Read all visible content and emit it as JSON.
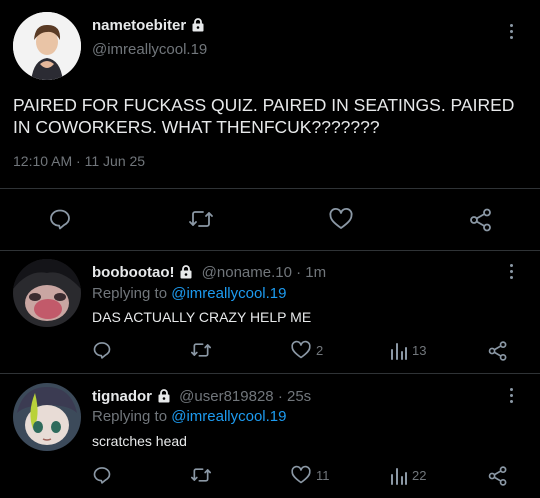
{
  "main_tweet": {
    "display_name": "nametoebiter",
    "handle": "@imreallycool.19",
    "text": "PAIRED FOR FUCKASS QUIZ. PAIRED IN SEATINGS. PAIRED IN COWORKERS. WHAT THENFCUK???????",
    "time": "12:10 AM",
    "separator": "·",
    "date": "11 Jun 25",
    "icons": [
      "reply-icon",
      "retweet-icon",
      "like-icon",
      "share-icon"
    ]
  },
  "replies": [
    {
      "display_name": "boobootao!",
      "handle": "@noname.10",
      "age": "· 1m",
      "replying_prefix": "Replying to",
      "replying_to": "@imreallycool.19",
      "text": "DAS ACTUALLY CRAZY HELP ME",
      "likes": "2",
      "views": "13"
    },
    {
      "display_name": "tignador",
      "handle": "@user819828",
      "age": "· 25s",
      "replying_prefix": "Replying to",
      "replying_to": "@imreallycool.19",
      "text": "scratches head",
      "likes": "11",
      "views": "22"
    }
  ],
  "colors": {
    "background": "#000000",
    "text": "#e7e9ea",
    "muted": "#71767b",
    "link": "#1d9bf0",
    "divider": "#2f3336"
  }
}
